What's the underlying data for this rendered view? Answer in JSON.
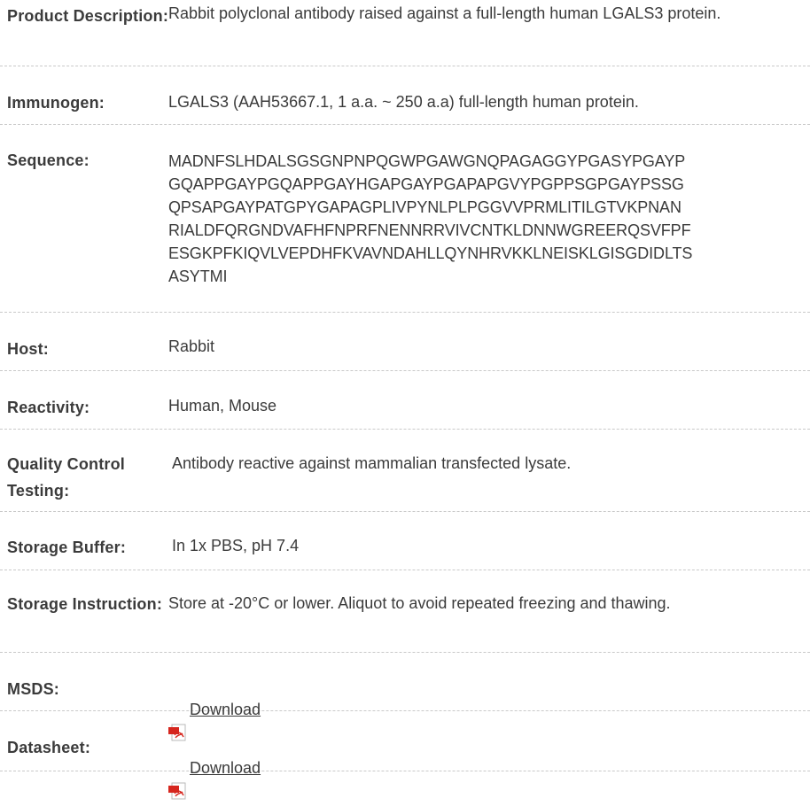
{
  "rows": [
    {
      "label": "Product Description:",
      "value": "Rabbit polyclonal antibody raised against a full-length human LGALS3 protein."
    },
    {
      "label": "Immunogen:",
      "value": "LGALS3 (AAH53667.1, 1 a.a. ~ 250 a.a) full-length human protein."
    },
    {
      "label": "Sequence:",
      "value": "MADNFSLHDALSGSGNPNPQGWPGAWGNQPAGAGGYPGASYPGAYP\nGQAPPGAYPGQAPPGAYHGAPGAYPGAPAPGVYPGPPSGPGAYPSSG\nQPSAPGAYPATGPYGAPAGPLIVPYNLPLPGGVVPRMLITILGTVKPNAN\nRIALDFQRGNDVAFHFNPRFNENNRRVIVCNTKLDNNWGREERQSVFPF\nESGKPFKIQVLVEPDHFKVAVNDAHLLQYNHRVKKLNEISKLGISGDIDLTS\nASYTMI"
    },
    {
      "label": "Host:",
      "value": "Rabbit"
    },
    {
      "label": "Reactivity:",
      "value": "Human, Mouse"
    },
    {
      "label": "Quality Control Testing:",
      "value": "Antibody reactive against mammalian transfected lysate."
    },
    {
      "label": "Storage Buffer:",
      "value": "In 1x PBS, pH 7.4"
    },
    {
      "label": "Storage Instruction:",
      "value": "Store at -20°C or lower. Aliquot to avoid repeated freezing and thawing."
    },
    {
      "label": "MSDS:",
      "link_text": "Download",
      "icon": "pdf-icon"
    },
    {
      "label": "Datasheet:",
      "link_text": "Download",
      "icon": "pdf-icon"
    }
  ],
  "colors": {
    "text": "#3b3b3b",
    "divider": "#c9c9c9",
    "pdf_red": "#d6261e"
  }
}
